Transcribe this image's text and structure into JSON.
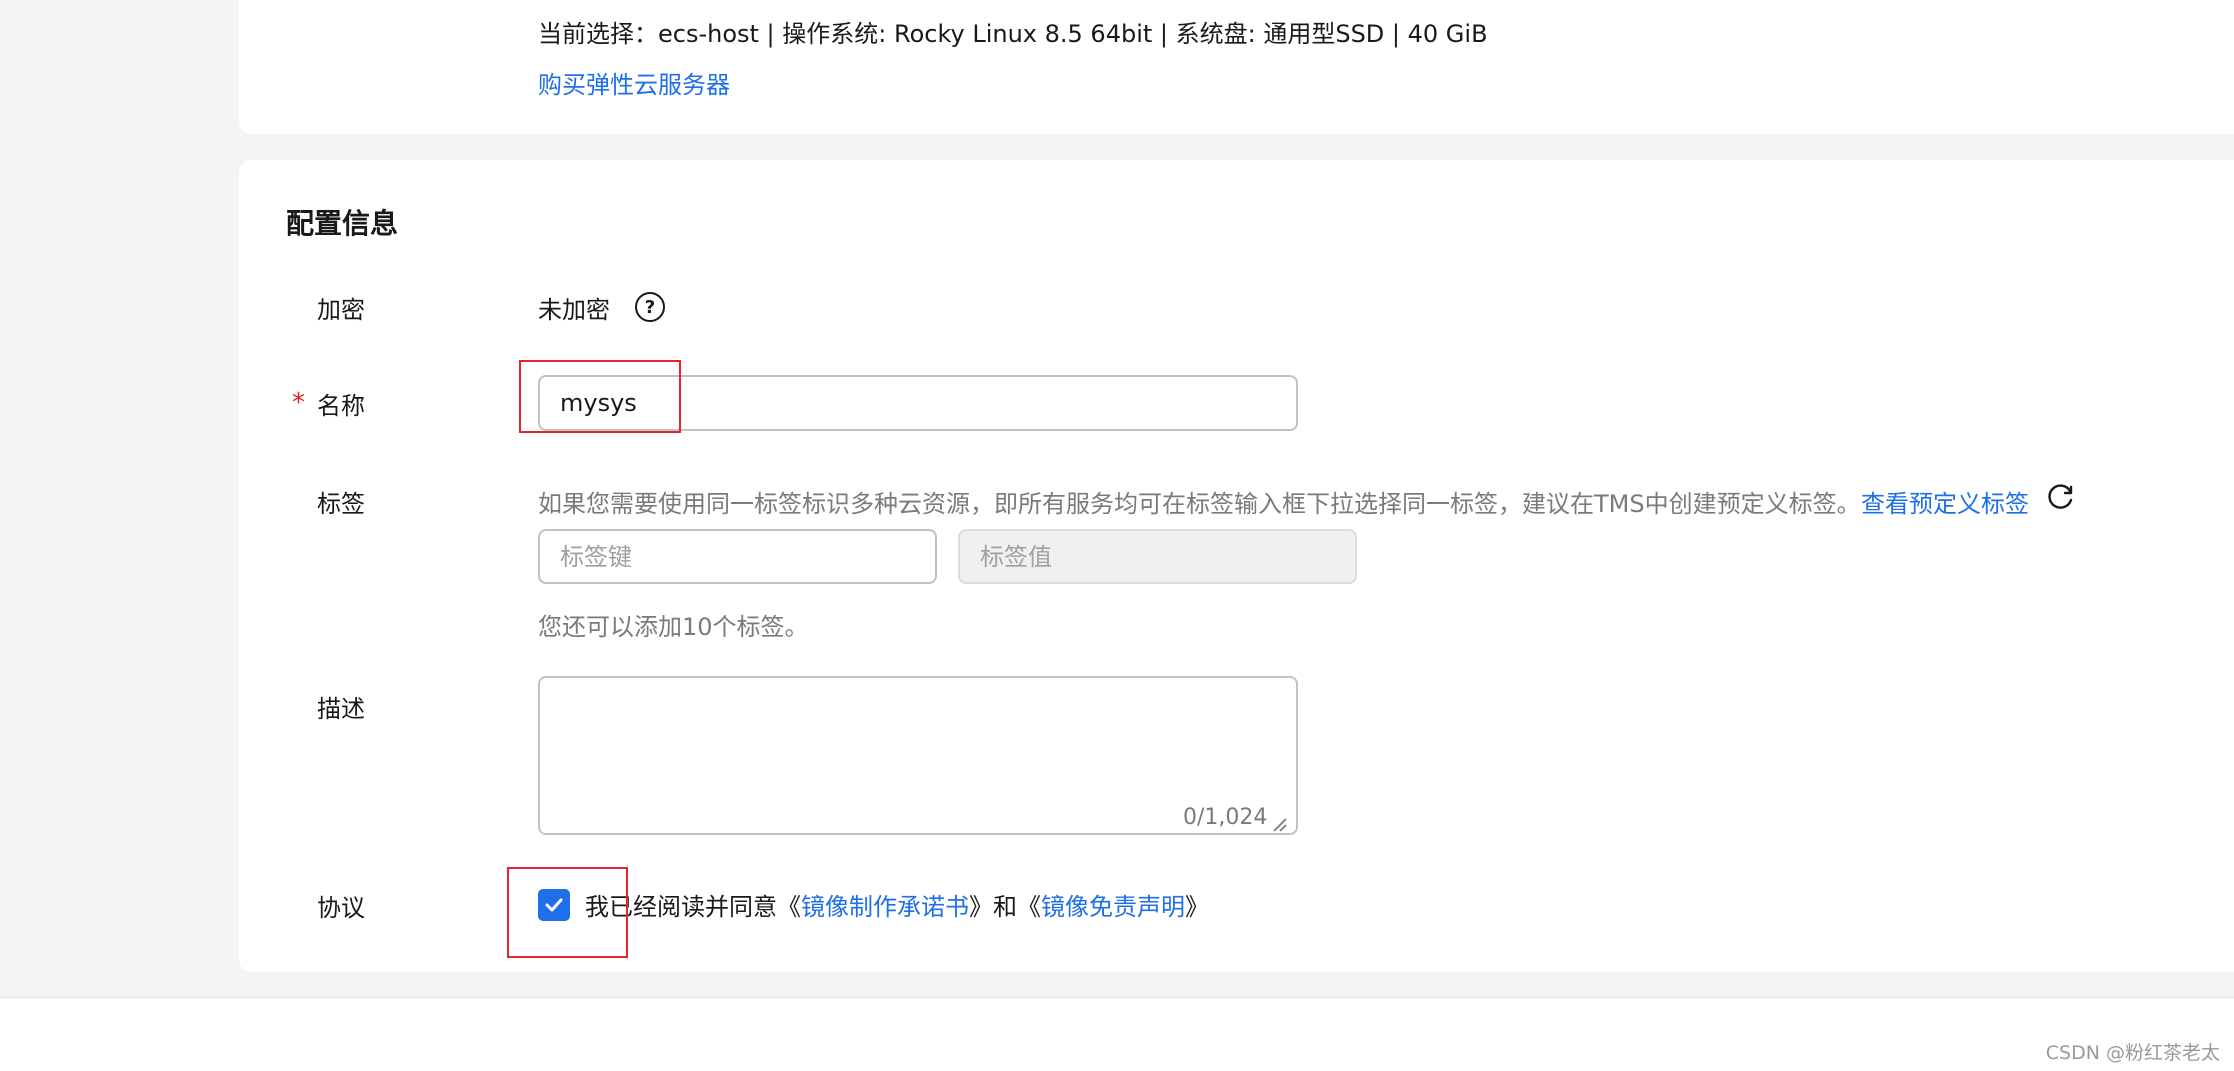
{
  "source_summary": {
    "text": "当前选择：ecs-host | 操作系统: Rocky Linux 8.5 64bit | 系统盘: 通用型SSD | 40 GiB",
    "buy_link": "购买弹性云服务器"
  },
  "config": {
    "section_title": "配置信息",
    "encryption": {
      "label": "加密",
      "value": "未加密",
      "help_icon": "question-circle-icon"
    },
    "name": {
      "required_mark": "*",
      "label": "名称",
      "value": "mysys"
    },
    "tags": {
      "label": "标签",
      "hint": "如果您需要使用同一标签标识多种云资源，即所有服务均可在标签输入框下拉选择同一标签，建议在TMS中创建预定义标签。",
      "view_link": "查看预定义标签",
      "refresh_icon": "refresh-icon",
      "key_placeholder": "标签键",
      "value_placeholder": "标签值",
      "remaining": "您还可以添加10个标签。"
    },
    "description": {
      "label": "描述",
      "value": "",
      "counter": "0/1,024"
    },
    "agreement": {
      "label": "协议",
      "checked": true,
      "text_prefix": "我已经阅读并同意《",
      "link1": "镜像制作承诺书",
      "text_middle": "》和《",
      "link2": "镜像免责声明",
      "text_suffix": "》"
    }
  },
  "colors": {
    "accent": "#1f6fe8",
    "required": "#e0212a",
    "highlight_box": "#e8232b",
    "page_background": "#f4f4f4"
  },
  "watermark": "CSDN @粉红茶老太"
}
